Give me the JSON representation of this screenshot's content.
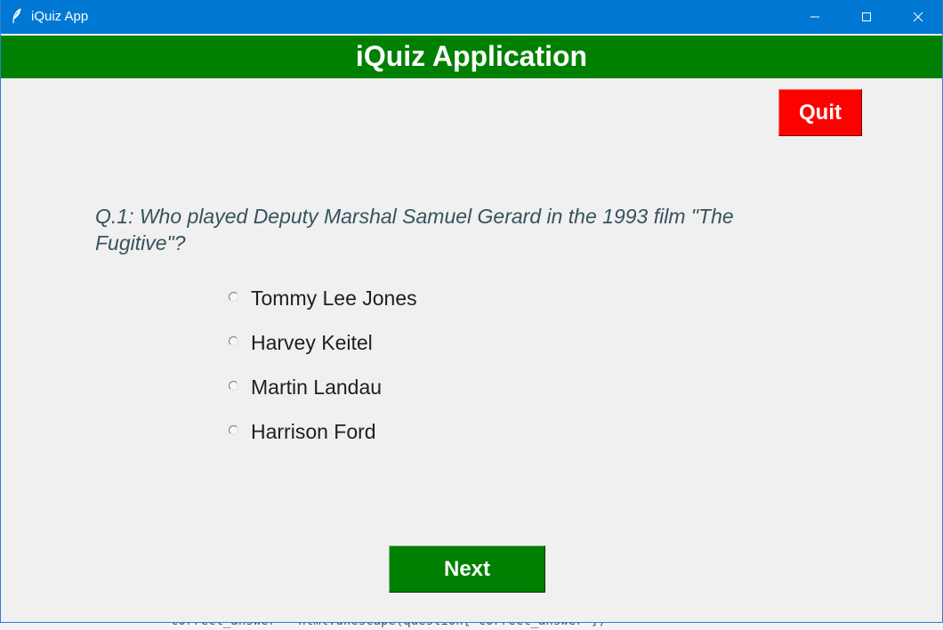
{
  "window": {
    "title": "iQuiz App",
    "icon": "feather-icon"
  },
  "header": {
    "title": "iQuiz Application"
  },
  "quit_label": "Quit",
  "question": {
    "text": "Q.1: Who played Deputy Marshal Samuel Gerard in the 1993 film \"The Fugitive\"?"
  },
  "options": [
    {
      "label": "Tommy Lee Jones"
    },
    {
      "label": "Harvey Keitel"
    },
    {
      "label": "Martin Landau"
    },
    {
      "label": "Harrison Ford"
    }
  ],
  "next_label": "Next",
  "background_code": "correct_answer = html.unescape(question[\"correct_answer\"])",
  "colors": {
    "titlebar": "#0078d4",
    "header": "#008000",
    "quit": "#ff0000",
    "next": "#008000",
    "question_text": "#36525e"
  }
}
